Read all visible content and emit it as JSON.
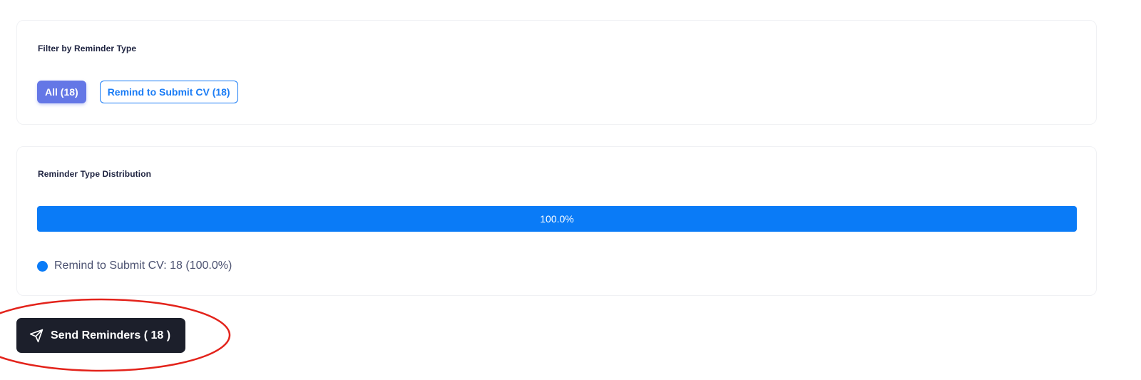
{
  "filter": {
    "title": "Filter by Reminder Type",
    "chips": [
      {
        "label": "All (18)",
        "active": true
      },
      {
        "label": "Remind to Submit CV (18)",
        "active": false
      }
    ]
  },
  "distribution": {
    "title": "Reminder Type Distribution",
    "bar": {
      "label": "100.0%",
      "fraction": 1.0,
      "color": "#0a7bf7"
    },
    "legend": [
      {
        "label": "Remind to Submit CV: 18 (100.0%)",
        "color": "#0a7bf7"
      }
    ]
  },
  "actions": {
    "send_label": "Send Reminders ( 18 )",
    "send_icon": "send-icon"
  },
  "colors": {
    "accent_active": "#6477e6",
    "accent_blue": "#1a7cf5",
    "button_dark": "#1c1f2b",
    "annotation_red": "#e3231b"
  }
}
